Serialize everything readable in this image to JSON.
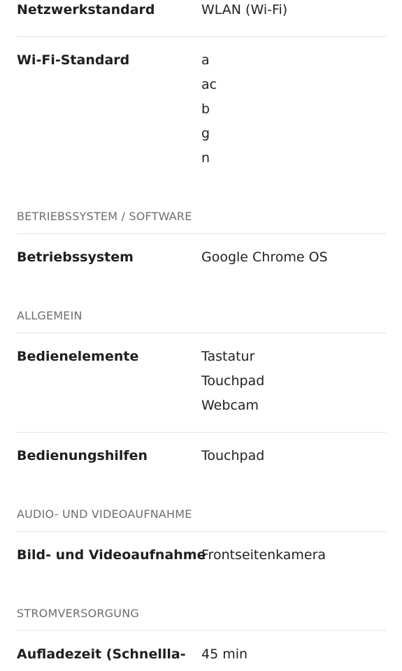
{
  "rows": [
    {
      "label": "Netzwerkstandard",
      "values": [
        "WLAN (Wi-Fi)"
      ]
    },
    {
      "label": "Wi-Fi-Standard",
      "values": [
        "a",
        "ac",
        "b",
        "g",
        "n"
      ]
    },
    {
      "label": "Betriebssystem",
      "values": [
        "Google Chrome OS"
      ]
    },
    {
      "label": "Bedienelemente",
      "values": [
        "Tastatur",
        "Touchpad",
        "Webcam"
      ]
    },
    {
      "label": "Bedienungshilfen",
      "values": [
        "Touchpad"
      ]
    },
    {
      "label": "Bild- und Videoaufnahme",
      "values": [
        "Frontseitenkamera"
      ]
    },
    {
      "label": "Aufladezeit (Schnellla-",
      "values": [
        "45 min"
      ]
    }
  ],
  "sections": [
    "BETRIEBSSYSTEM / SOFTWARE",
    "ALLGEMEIN",
    "AUDIO- UND VIDEOAUFNAHME",
    "STROMVERSORGUNG"
  ]
}
